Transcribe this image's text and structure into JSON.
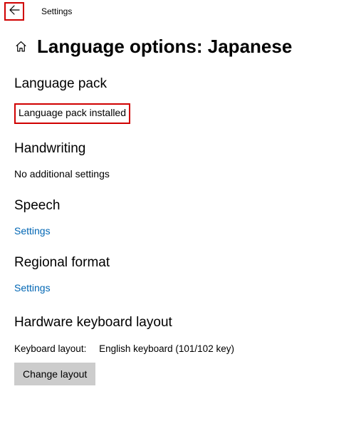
{
  "titlebar": {
    "app_name": "Settings"
  },
  "header": {
    "page_title": "Language options: Japanese"
  },
  "sections": {
    "language_pack": {
      "heading": "Language pack",
      "status": "Language pack installed"
    },
    "handwriting": {
      "heading": "Handwriting",
      "status": "No additional settings"
    },
    "speech": {
      "heading": "Speech",
      "link": "Settings"
    },
    "regional_format": {
      "heading": "Regional format",
      "link": "Settings"
    },
    "hardware_keyboard": {
      "heading": "Hardware keyboard layout",
      "label": "Keyboard layout:",
      "value": "English keyboard (101/102 key)",
      "button": "Change layout"
    }
  }
}
